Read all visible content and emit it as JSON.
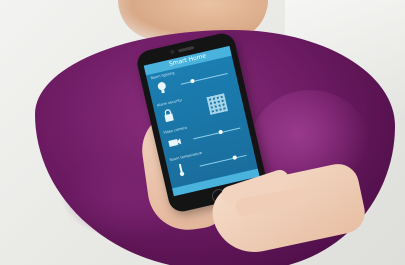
{
  "app": {
    "title": "Smart Home"
  },
  "sections": [
    {
      "label": "Room lighting",
      "icon": "lightbulb-icon"
    },
    {
      "label": "Alarm security",
      "icon": "lock-icon"
    },
    {
      "label": "Video camera",
      "icon": "camera-icon"
    },
    {
      "label": "Room temperature",
      "icon": "thermometer-icon"
    }
  ],
  "colors": {
    "screen": "#1b7fb3",
    "app_bar": "#49b3de",
    "dress": "#6d1b63"
  }
}
